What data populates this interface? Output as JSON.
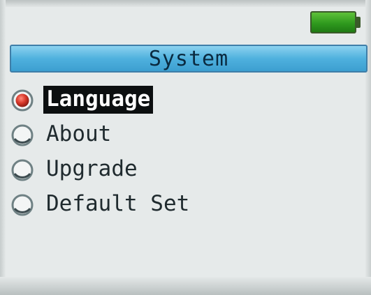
{
  "status_bar": {
    "battery_icon": "battery-full-icon",
    "battery_color": "#2f9a1e"
  },
  "header": {
    "title": "System",
    "accent_color": "#4fb1de"
  },
  "menu": {
    "selected_index": 0,
    "items": [
      {
        "label": "Language",
        "icon": "radio-selected-icon",
        "selected": true
      },
      {
        "label": "About",
        "icon": "radio-empty-icon",
        "selected": false
      },
      {
        "label": "Upgrade",
        "icon": "radio-empty-icon",
        "selected": false
      },
      {
        "label": "Default Set",
        "icon": "radio-empty-icon",
        "selected": false
      }
    ],
    "selected_color": "#d8392b"
  }
}
